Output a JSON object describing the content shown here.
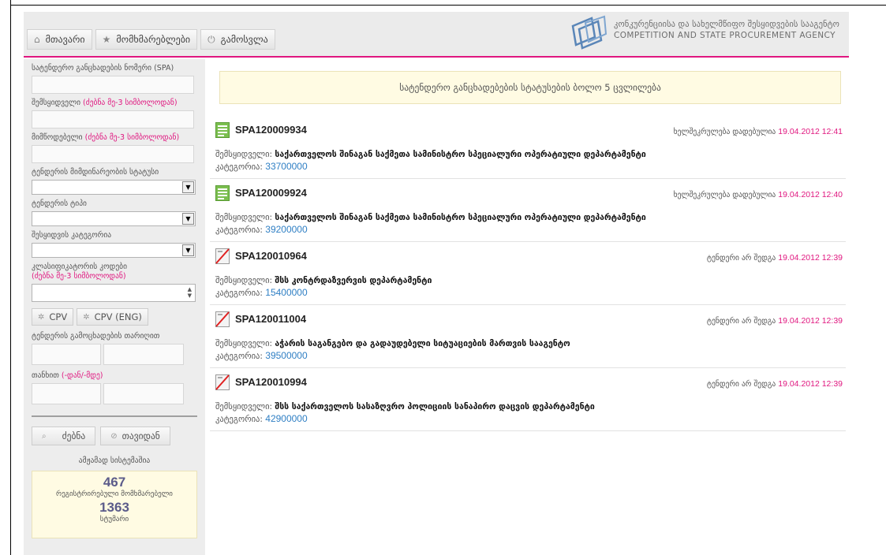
{
  "nav": {
    "home": "მთავარი",
    "users": "მომხმარებლები",
    "logout": "გამოსვლა"
  },
  "agency": {
    "name_ka": "კონკურენციისა და სახელმწიფო შესყიდვების სააგენტო",
    "name_en": "COMPETITION AND STATE PROCUREMENT AGENCY"
  },
  "filters": {
    "spa_label": "სატენდერო განცხადების ნომერი (SPA)",
    "buyer_label": "შემსყიდველი",
    "buyer_hint": "(ძებნა მე-3 სიმბოლოდან)",
    "supplier_label": "მიმწოდებელი",
    "supplier_hint": "(ძებნა მე-3 სიმბოლოდან)",
    "status_label": "ტენდერის მიმდინარეობის სტატუსი",
    "type_label": "ტენდერის ტიპი",
    "category_label": "შესყიდვის კატეგორია",
    "class_label": "კლასიფიკატორის კოდები",
    "class_hint": "(ძებნა მე-3 სიმბოლოდან)",
    "cpv": "CPV",
    "cpv_eng": "CPV (ENG)",
    "announce_date_label": "ტენდერის გამოცხადების თარიღით",
    "amount_label": "თანხით",
    "amount_hint": "(-დან/-მდე)",
    "search": "ძებნა",
    "reset": "თავიდან"
  },
  "stats": {
    "title": "ამჟამად სისტემაშია",
    "users_count": "467",
    "users_label": "რეგისტრირებული მომხმარებელი",
    "guests_count": "1363",
    "guests_label": "სტუმარი"
  },
  "notice": "სატენდერო განცხადებების სტატუსების ბოლო 5 ცვლილება",
  "labels": {
    "buyer": "შემსყიდველი:",
    "category": "კატეგორია:"
  },
  "tenders": [
    {
      "spa": "SPA120009934",
      "status": "ხელშეკრულება დადებულია",
      "date": "19.04.2012 12:41",
      "buyer": "საქართველოს შინაგან საქმეთა სამინისტრო სპეციალური ოპერატიული დეპარტამენტი",
      "category": "33700000",
      "icon": "contract-doc-icon"
    },
    {
      "spa": "SPA120009924",
      "status": "ხელშეკრულება დადებულია",
      "date": "19.04.2012 12:40",
      "buyer": "საქართველოს შინაგან საქმეთა სამინისტრო სპეციალური ოპერატიული დეპარტამენტი",
      "category": "39200000",
      "icon": "contract-doc-icon"
    },
    {
      "spa": "SPA120010964",
      "status": "ტენდერი არ შედგა",
      "date": "19.04.2012 12:39",
      "buyer": "შსს კონტრდაზვერვის დეპარტამენტი",
      "category": "15400000",
      "icon": "cancelled-doc-icon"
    },
    {
      "spa": "SPA120011004",
      "status": "ტენდერი არ შედგა",
      "date": "19.04.2012 12:39",
      "buyer": "აჭარის საგანგებო და გადაუდებელი სიტუაციების მართვის სააგენტო",
      "category": "39500000",
      "icon": "cancelled-doc-icon"
    },
    {
      "spa": "SPA120010994",
      "status": "ტენდერი არ შედგა",
      "date": "19.04.2012 12:39",
      "buyer": "შსს საქართველოს სასაზღვრო პოლიციის სანაპირო დაცვის დეპარტამენტი",
      "category": "42900000",
      "icon": "cancelled-doc-icon"
    }
  ],
  "colors": {
    "accent": "#e0167f",
    "link": "#2f7fc4",
    "notice_bg": "#fffbe3",
    "header_bg": "#ebebeb",
    "sidebar_bg": "#ededed"
  }
}
